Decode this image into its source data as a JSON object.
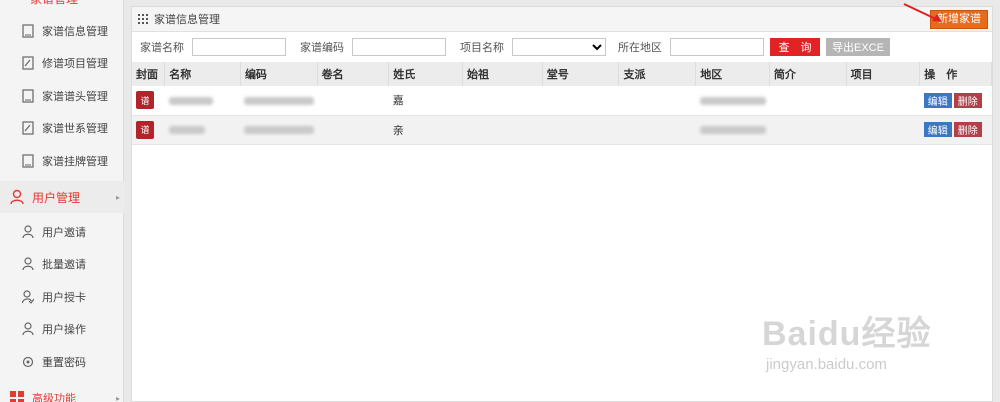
{
  "sidebar": {
    "top_partial": "家谱管理",
    "items": [
      {
        "label": "家谱信息管理",
        "icon": "document-icon"
      },
      {
        "label": "修谱项目管理",
        "icon": "edit-document-icon"
      },
      {
        "label": "家谱谱头管理",
        "icon": "document-icon"
      },
      {
        "label": "家谱世系管理",
        "icon": "edit-document-icon"
      },
      {
        "label": "家谱挂牌管理",
        "icon": "document-icon"
      }
    ],
    "user_mgmt": "用户管理",
    "user_items": [
      {
        "label": "用户邀请",
        "icon": "user-icon"
      },
      {
        "label": "批量邀请",
        "icon": "user-icon"
      },
      {
        "label": "用户授卡",
        "icon": "user-check-icon"
      },
      {
        "label": "用户操作",
        "icon": "user-icon"
      },
      {
        "label": "重置密码",
        "icon": "reset-icon"
      }
    ],
    "advanced": "高级功能"
  },
  "panel": {
    "title": "家谱信息管理",
    "new_button": "新增家谱"
  },
  "filter": {
    "name_label": "家谱名称",
    "code_label": "家谱编码",
    "project_label": "项目名称",
    "region_label": "所在地区",
    "query_button": "查　询",
    "export_button": "导出EXCE"
  },
  "table": {
    "headers": [
      "封面",
      "名称",
      "编码",
      "卷名",
      "姓氏",
      "始祖",
      "堂号",
      "支派",
      "地区",
      "简介",
      "项目",
      "操　作"
    ],
    "rows": [
      {
        "cover": "谱",
        "surname": "嘉",
        "edit": "编辑",
        "delete": "删除"
      },
      {
        "cover": "谱",
        "surname": "亲",
        "edit": "编辑",
        "delete": "删除"
      }
    ]
  },
  "watermark": {
    "logo": "Baidu经验",
    "url": "jingyan.baidu.com"
  },
  "colors": {
    "accent_red": "#e53935",
    "new_button": "#e86b1c",
    "edit_blue": "#3b78c4",
    "delete_red": "#b0404a"
  }
}
